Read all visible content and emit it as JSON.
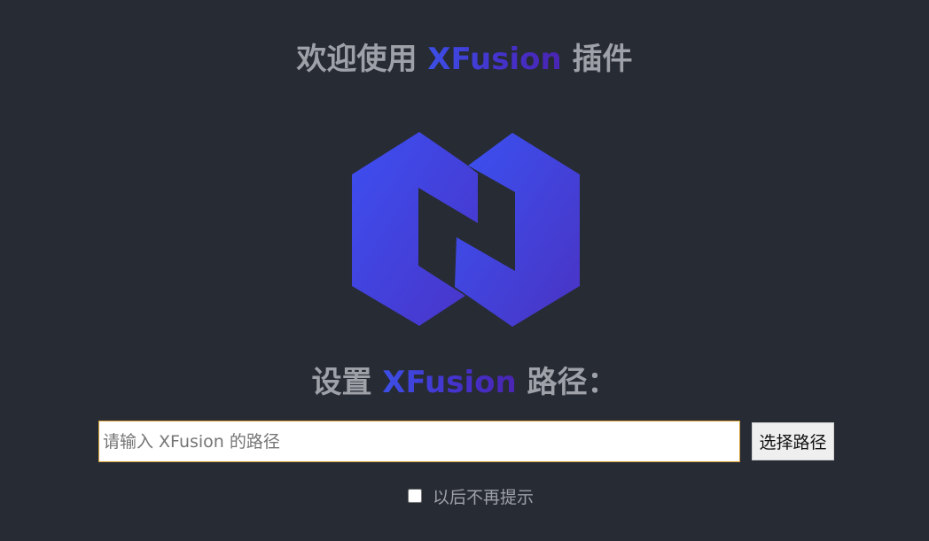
{
  "header": {
    "title_prefix": "欢迎使用 ",
    "title_brand": "XFusion",
    "title_suffix": " 插件"
  },
  "logo": {
    "icon": "xfusion-logo-icon",
    "colors": {
      "left_start": "#3c4ff0",
      "left_end": "#4a34c8",
      "right_start": "#3a52f2",
      "right_end": "#4a33c3"
    }
  },
  "setup": {
    "title_prefix": "设置 ",
    "title_brand": "XFusion",
    "title_suffix": " 路径："
  },
  "path_input": {
    "value": "",
    "placeholder": "请输入 XFusion 的路径"
  },
  "choose_button": {
    "label": "选择路径"
  },
  "dont_show": {
    "label": "以后不再提示",
    "checked": false
  },
  "colors": {
    "background": "#272b34",
    "text": "#9ea1a7",
    "brand": "#3c4fe6",
    "input_border": "#d9a13a"
  }
}
